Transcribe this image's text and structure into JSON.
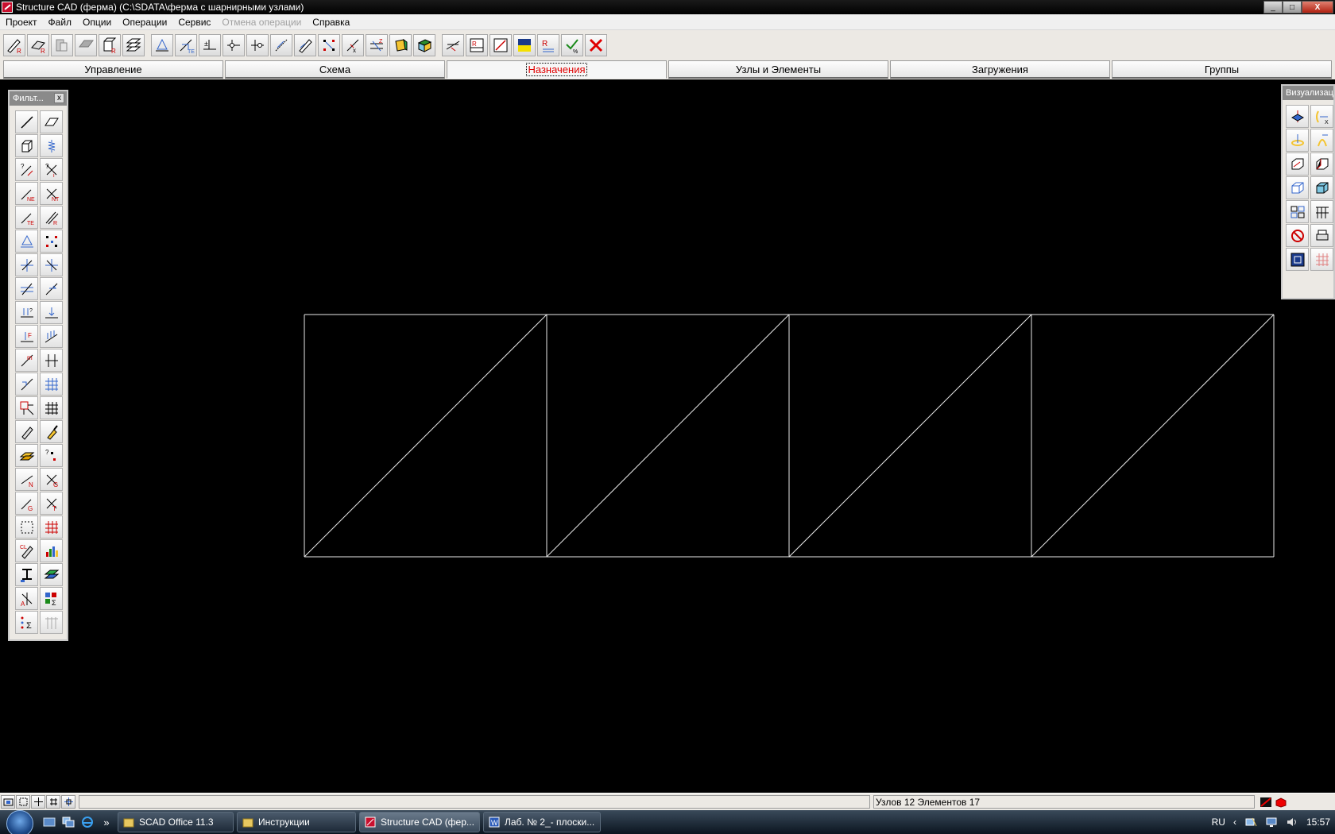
{
  "window": {
    "title": "Structure CAD (ферма) (C:\\SDATA\\ферма с шарнирными узлами)",
    "minimize": "_",
    "maximize": "□",
    "close": "X"
  },
  "menu": {
    "items": [
      "Проект",
      "Файл",
      "Опции",
      "Операции",
      "Сервис",
      "Отмена операции",
      "Справка"
    ]
  },
  "tabs": [
    {
      "label": "Управление",
      "active": false
    },
    {
      "label": "Схема",
      "active": false
    },
    {
      "label": "Назначения",
      "active": true
    },
    {
      "label": "Узлы и Элементы",
      "active": false
    },
    {
      "label": "Загружения",
      "active": false
    },
    {
      "label": "Группы",
      "active": false
    }
  ],
  "filter_panel": {
    "title": "Фильт...",
    "close": "x"
  },
  "vis_panel": {
    "title": "Визуализац"
  },
  "statusbar": {
    "info": "Узлов 12 Элементов 17"
  },
  "taskbar": {
    "ql_more": "»",
    "tasks": [
      {
        "label": "SCAD Office 11.3"
      },
      {
        "label": "Инструкции"
      },
      {
        "label": "Structure CAD (фер..."
      },
      {
        "label": "Лаб. № 2_- плоски..."
      }
    ],
    "tray": {
      "lang": "RU",
      "arrow": "‹",
      "time": "15:57"
    }
  },
  "truss": {
    "panels": 4,
    "line_color": "#e8e8e8"
  }
}
